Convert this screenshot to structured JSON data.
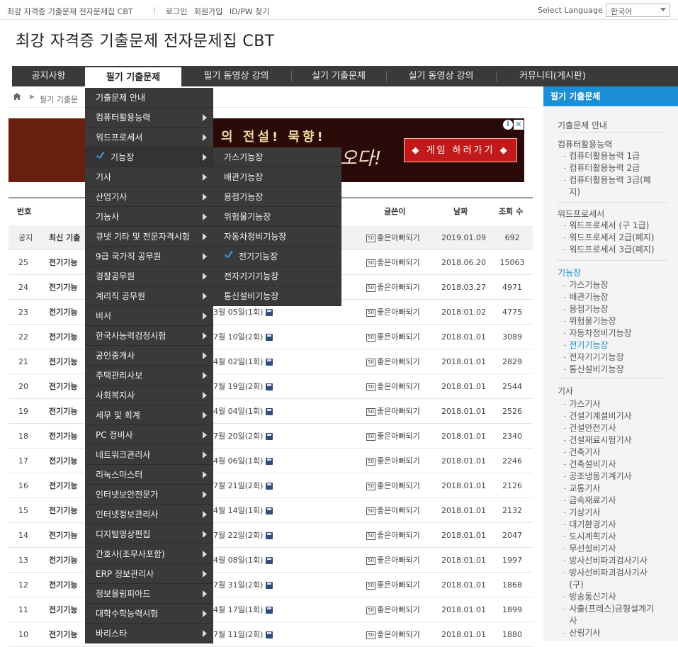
{
  "topbar": {
    "site_name": "최강 자격증 기출문제 전자문제집 CBT",
    "separator": "|",
    "links": [
      "로그인",
      "회원가입",
      "ID/PW 찾기"
    ],
    "select_language_label": "Select Language",
    "language_value": "한국어"
  },
  "header": {
    "title": "최강 자격증 기출문제 전자문제집 CBT"
  },
  "nav": {
    "items": [
      "공지사항",
      "필기 기출문제",
      "필기 동영상 강의",
      "실기 기출문제",
      "실기 동영상 강의",
      "커뮤니티(게시판)"
    ]
  },
  "breadcrumb": {
    "current": "필기 기출문"
  },
  "banner": {
    "headline": "의 전설! 묵향!",
    "subline": "오다!",
    "cta": "◆ 게임 하러가기 ◆",
    "ad_info": "i",
    "ad_close": "✕"
  },
  "board": {
    "headers": {
      "num": "번호",
      "writer": "글쓴이",
      "date": "날짜",
      "views": "조회 수"
    },
    "notice": {
      "num": "공지",
      "title": "최신 기출",
      "writer": "좋은아빠되기",
      "level": "50",
      "date": "2019.01.09",
      "views": "692"
    },
    "rows": [
      {
        "num": "25",
        "title": "전기기능",
        "suffix": "",
        "writer": "좋은아빠되기",
        "level": "50",
        "date": "2018.06.20",
        "views": "15063"
      },
      {
        "num": "24",
        "title": "전기기능",
        "suffix": "",
        "writer": "좋은아빠되기",
        "level": "50",
        "date": "2018.03.27",
        "views": "4971"
      },
      {
        "num": "23",
        "title": "전기기능",
        "suffix": "3월 05일(1회)",
        "writer": "좋은아빠되기",
        "level": "50",
        "date": "2018.01.02",
        "views": "4775"
      },
      {
        "num": "22",
        "title": "전기기능",
        "suffix": "7월 10일(2회)",
        "writer": "좋은아빠되기",
        "level": "50",
        "date": "2018.01.01",
        "views": "3089"
      },
      {
        "num": "21",
        "title": "전기기능",
        "suffix": "4월 02일(1회)",
        "writer": "좋은아빠되기",
        "level": "50",
        "date": "2018.01.01",
        "views": "2829"
      },
      {
        "num": "20",
        "title": "전기기능",
        "suffix": "7월 19일(2회)",
        "writer": "좋은아빠되기",
        "level": "50",
        "date": "2018.01.01",
        "views": "2544"
      },
      {
        "num": "19",
        "title": "전기기능",
        "suffix": "4월 04일(1회)",
        "writer": "좋은아빠되기",
        "level": "50",
        "date": "2018.01.01",
        "views": "2526"
      },
      {
        "num": "18",
        "title": "전기기능",
        "suffix": "7월 20일(2회)",
        "writer": "좋은아빠되기",
        "level": "50",
        "date": "2018.01.01",
        "views": "2340"
      },
      {
        "num": "17",
        "title": "전기기능",
        "suffix": "4월 06일(1회)",
        "writer": "좋은아빠되기",
        "level": "50",
        "date": "2018.01.01",
        "views": "2246"
      },
      {
        "num": "16",
        "title": "전기기능",
        "suffix": "7월 21일(2회)",
        "writer": "좋은아빠되기",
        "level": "50",
        "date": "2018.01.01",
        "views": "2126"
      },
      {
        "num": "15",
        "title": "전기기능",
        "suffix": "4월 14일(1회)",
        "writer": "좋은아빠되기",
        "level": "50",
        "date": "2018.01.01",
        "views": "2132"
      },
      {
        "num": "14",
        "title": "전기기능",
        "suffix": "7월 22일(2회)",
        "writer": "좋은아빠되기",
        "level": "50",
        "date": "2018.01.01",
        "views": "2047"
      },
      {
        "num": "13",
        "title": "전기기능",
        "suffix": "4월 08일(1회)",
        "writer": "좋은아빠되기",
        "level": "50",
        "date": "2018.01.01",
        "views": "1997"
      },
      {
        "num": "12",
        "title": "전기기능",
        "suffix": "7월 31일(2회)",
        "writer": "좋은아빠되기",
        "level": "50",
        "date": "2018.01.01",
        "views": "1868"
      },
      {
        "num": "11",
        "title": "전기기능",
        "suffix": "4월 17일(1회)",
        "writer": "좋은아빠되기",
        "level": "50",
        "date": "2018.01.01",
        "views": "1899"
      },
      {
        "num": "10",
        "title": "전기기능",
        "suffix": "7월 11일(2회)",
        "writer": "좋은아빠되기",
        "level": "50",
        "date": "2018.01.01",
        "views": "1880"
      }
    ]
  },
  "menu": {
    "items": [
      "기출문제 안내",
      "컴퓨터활용능력",
      "워드프로세서",
      "기능장",
      "기사",
      "산업기사",
      "기능사",
      "큐넷 기타 및 전문자격시험",
      "9급 국가직 공무원",
      "경찰공무원",
      "계리직 공무원",
      "비서",
      "한국사능력검정시험",
      "공인중개사",
      "주택관리사보",
      "사회복지사",
      "세무 및 회계",
      "PC 정비사",
      "네트워크관리사",
      "리눅스마스터",
      "인터넷보안전문가",
      "인터넷정보관리사",
      "디지털영상편집",
      "간호사(조무사포함)",
      "ERP 정보관리사",
      "정보올림피아드",
      "대학수학능력시험",
      "바리스타"
    ],
    "submenu": [
      "가스기능장",
      "배관기능장",
      "용접기능장",
      "위험물기능장",
      "자동차정비기능장",
      "전기기능장",
      "전자기기기능장",
      "통신설비기능장"
    ]
  },
  "sidebar": {
    "heading": "필기 기출문제",
    "guide": "기출문제 안내",
    "computer": {
      "title": "컴퓨터활용능력",
      "items": [
        "컴퓨터활용능력 1급",
        "컴퓨터활용능력 2급",
        "컴퓨터활용능력 3급(폐",
        "지)"
      ]
    },
    "word": {
      "title": "워드프로세서",
      "items": [
        "워드프로세서 (구 1급)",
        "워드프로세서 2급(폐지)",
        "워드프로세서 3급(폐지)"
      ]
    },
    "master": {
      "title": "기능장",
      "items": [
        "가스기능장",
        "배관기능장",
        "용접기능장",
        "위험물기능장",
        "자동차정비기능장",
        "전기기능장",
        "전자기기기능장",
        "통신설비기능장"
      ]
    },
    "engineer": {
      "title": "기사",
      "items": [
        "가스기사",
        "건설기계설비기사",
        "건설안전기사",
        "건설재료시험기사",
        "건축기사",
        "건축설비기사",
        "공조냉동기계기사",
        "교통기사",
        "금속재료기사",
        "기상기사",
        "대기환경기사",
        "도시계획기사",
        "무선설비기사",
        "방사선비파괴검사기사",
        "방사선비파괴검사기사",
        "(구)",
        "방송통신기사",
        "사출(프레스)금형설계기",
        "사",
        "산림기사"
      ]
    }
  },
  "colors": {
    "nav_bg": "#3a3a3a",
    "sidebar_head": "#1a8fd6",
    "check": "#3fa0e8"
  }
}
